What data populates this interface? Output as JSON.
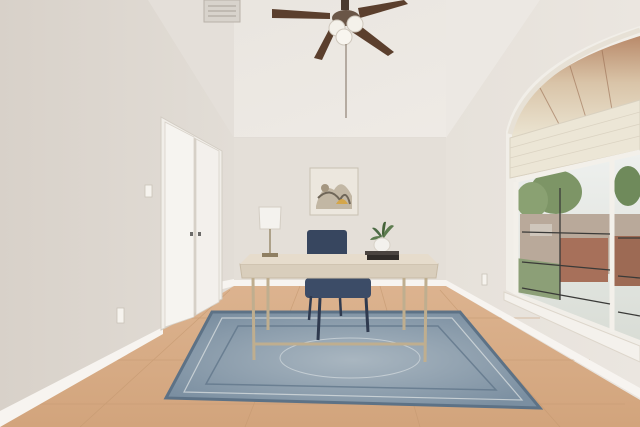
{
  "scene": {
    "kind": "staged home office interior",
    "colors": {
      "ceiling": "#ebe7e2",
      "back_wall": "#e3ded8",
      "left_wall": "#ddd6cf",
      "right_wall": "#e7e2dc",
      "floor_tile": "#d7ab85",
      "baseboard": "#f6f3ef",
      "door": "#f4f2ee",
      "desk_top": "#d8cdbb",
      "desk_frame": "#bfae8f",
      "chair": "#3a4a66",
      "rug": "#7f94a6",
      "shade": "#ece6d6",
      "window_trim": "#f2efe9",
      "foliage": "#7d9566"
    },
    "icons": [
      "ceiling-fan-icon",
      "air-vent-icon",
      "table-lamp-icon",
      "potted-plant-icon",
      "wall-art-icon",
      "light-switch-icon",
      "power-outlet-icon"
    ]
  }
}
